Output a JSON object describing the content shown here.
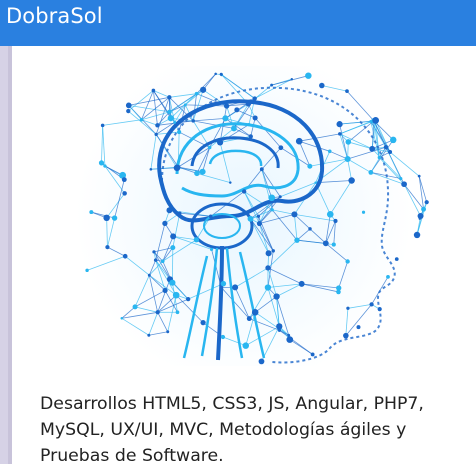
{
  "brand": {
    "name": "DobraSol"
  },
  "card": {
    "description": "Desarrollos HTML5, CSS3, JS, Angular, PHP7, MySQL, UX/UI, MVC, Metodologías ágiles y Pruebas de Software."
  },
  "colors": {
    "navbar": "#2a80e0",
    "page_bg": "#d6d2e6",
    "card_bg": "#ffffff",
    "illustration_dark": "#1b67c9",
    "illustration_light": "#29b6f0"
  },
  "hero_image": {
    "icon": "brain-network-head-illustration"
  }
}
